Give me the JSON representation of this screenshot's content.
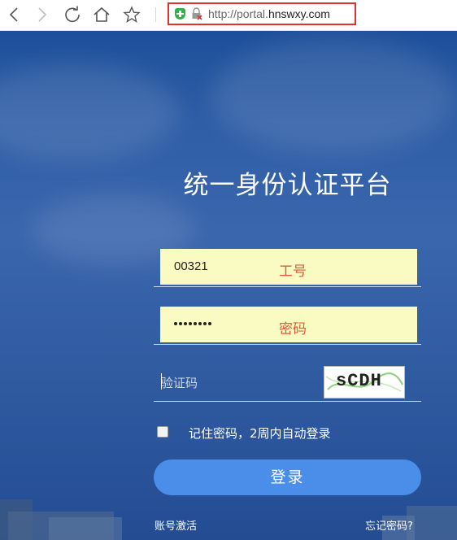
{
  "browser": {
    "url_prefix": "http://portal.",
    "url_domain": "hnswxy.com"
  },
  "login": {
    "title": "统一身份认证平台",
    "username_value": "00321",
    "username_hint": "工号",
    "password_hint": "密码",
    "password_length": 8,
    "captcha_placeholder": "验证码",
    "captcha_text": "sCDH",
    "remember_label": "记住密码，2周内自动登录",
    "login_button": "登录",
    "activate_link": "账号激活",
    "forgot_link": "忘记密码?"
  }
}
